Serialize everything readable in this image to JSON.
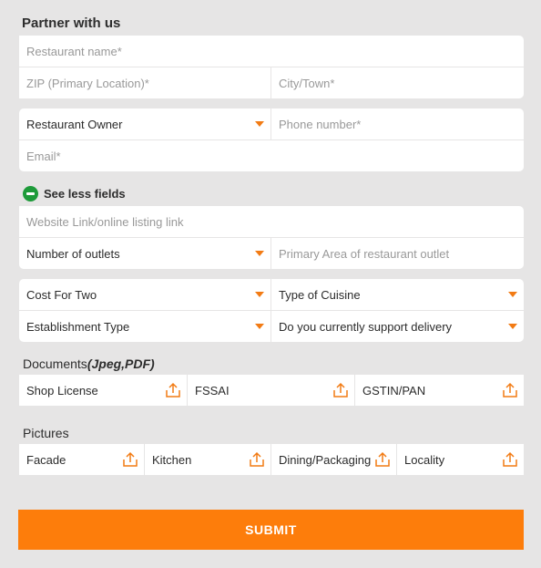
{
  "form": {
    "title": "Partner with us",
    "restaurant_name": {
      "placeholder": "Restaurant name*"
    },
    "zip": {
      "placeholder": "ZIP (Primary Location)*"
    },
    "city": {
      "placeholder": "City/Town*"
    },
    "role": {
      "value": "Restaurant Owner"
    },
    "phone": {
      "placeholder": "Phone number*"
    },
    "email": {
      "placeholder": "Email*"
    },
    "toggle_label": "See less fields",
    "website": {
      "placeholder": "Website Link/online listing link"
    },
    "outlets": {
      "value": "Number of outlets"
    },
    "primary_area": {
      "placeholder": "Primary Area of restaurant outlet"
    },
    "cost_for_two": {
      "value": "Cost For Two"
    },
    "cuisine": {
      "value": "Type of Cuisine"
    },
    "establishment": {
      "value": "Establishment Type"
    },
    "delivery": {
      "value": "Do you currently support delivery"
    }
  },
  "documents": {
    "title": "Documents",
    "title_suffix": "(Jpeg,PDF)",
    "items": [
      "Shop License",
      "FSSAI",
      "GSTIN/PAN"
    ]
  },
  "pictures": {
    "title": "Pictures",
    "items": [
      "Facade",
      "Kitchen",
      "Dining/Packaging",
      "Locality"
    ]
  },
  "submit_label": "SUBMIT",
  "colors": {
    "accent": "#fd7d0b",
    "caret": "#f27b14",
    "toggle_green": "#1e9b3a",
    "background": "#e6e5e5"
  },
  "icons": {
    "dropdown": "chevron-down-icon",
    "upload": "upload-icon",
    "toggle": "minus-circle-icon"
  }
}
